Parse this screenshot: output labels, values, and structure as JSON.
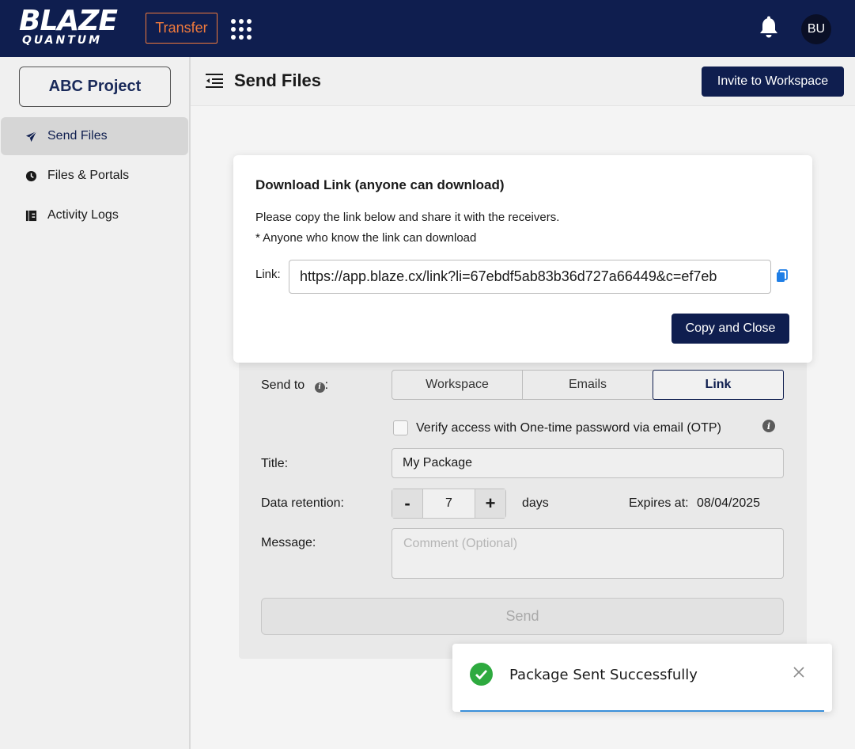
{
  "topbar": {
    "logo_main": "BLAZE",
    "logo_sub": "QUANTUM",
    "transfer_label": "Transfer",
    "avatar_initials": "BU"
  },
  "sidebar": {
    "project_label": "ABC Project",
    "items": [
      {
        "label": "Send Files",
        "icon": "paper-plane-icon",
        "active": true
      },
      {
        "label": "Files & Portals",
        "icon": "clock-icon",
        "active": false
      },
      {
        "label": "Activity Logs",
        "icon": "log-book-icon",
        "active": false
      }
    ]
  },
  "header": {
    "title": "Send Files",
    "invite_label": "Invite to Workspace"
  },
  "form": {
    "send_to_label": "Send to",
    "send_to_suffix": ":",
    "send_options": [
      "Workspace",
      "Emails",
      "Link"
    ],
    "selected_option": "Link",
    "otp_label": "Verify access with One-time password via email (OTP)",
    "title_label": "Title:",
    "title_value": "My Package",
    "retention_label": "Data retention:",
    "retention_minus": "-",
    "retention_value": "7",
    "retention_plus": "+",
    "retention_unit": "days",
    "expires_label": "Expires at:",
    "expires_value": "08/04/2025",
    "message_label": "Message:",
    "message_placeholder": "Comment (Optional)",
    "send_label": "Send"
  },
  "modal": {
    "title": "Download Link (anyone can download)",
    "desc_line1": "Please copy the link below and share it with the receivers.",
    "desc_line2": "* Anyone who know the link can download",
    "link_label": "Link:",
    "link_value": "https://app.blaze.cx/link?li=67ebdf5ab83b36d727a66449&c=ef7eb",
    "copy_close_label": "Copy and Close"
  },
  "toast": {
    "message": "Package Sent Successfully"
  },
  "colors": {
    "brand_navy": "#0f1e4f",
    "accent_orange": "#f07a3c",
    "success_green": "#2eaa3f"
  }
}
